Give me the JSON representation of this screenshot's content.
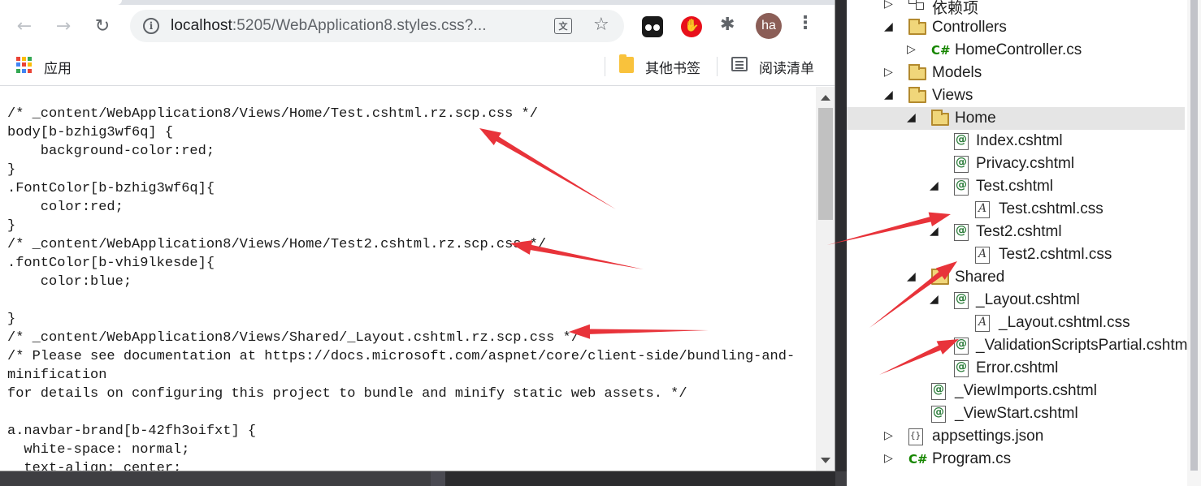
{
  "browser": {
    "url_host": "localhost",
    "url_rest": ":5205/WebApplication8.styles.css?...",
    "avatar_initials": "ha",
    "bookmarks": {
      "apps_label": "应用",
      "other_bookmarks": "其他书签",
      "reading_list": "阅读清单"
    }
  },
  "code_lines": [
    "/* _content/WebApplication8/Views/Home/Test.cshtml.rz.scp.css */",
    "body[b-bzhig3wf6q] {",
    "    background-color:red;",
    "}",
    ".FontColor[b-bzhig3wf6q]{",
    "    color:red;",
    "}",
    "/* _content/WebApplication8/Views/Home/Test2.cshtml.rz.scp.css */",
    ".fontColor[b-vhi9lkesde]{",
    "    color:blue;",
    "",
    "}",
    "/* _content/WebApplication8/Views/Shared/_Layout.cshtml.rz.scp.css */",
    "/* Please see documentation at https://docs.microsoft.com/aspnet/core/client-side/bundling-and-",
    "minification",
    "for details on configuring this project to bundle and minify static web assets. */",
    "",
    "a.navbar-brand[b-42fh3oifxt] {",
    "  white-space: normal;",
    "  text-align: center;"
  ],
  "explorer": {
    "items": [
      {
        "label": "依赖项",
        "icon": "dependencies-icon",
        "arrow": "▷",
        "level": 0
      },
      {
        "label": "Controllers",
        "icon": "folder-icon",
        "arrow": "◢",
        "level": 0
      },
      {
        "label": "HomeController.cs",
        "icon": "csharp-file-icon",
        "arrow": "▷",
        "level": 1
      },
      {
        "label": "Models",
        "icon": "folder-icon",
        "arrow": "▷",
        "level": 0
      },
      {
        "label": "Views",
        "icon": "folder-icon",
        "arrow": "◢",
        "level": 0
      },
      {
        "label": "Home",
        "icon": "folder-icon",
        "arrow": "◢",
        "level": 1,
        "selected": true
      },
      {
        "label": "Index.cshtml",
        "icon": "razor-file-icon",
        "arrow": "",
        "level": 2
      },
      {
        "label": "Privacy.cshtml",
        "icon": "razor-file-icon",
        "arrow": "",
        "level": 2
      },
      {
        "label": "Test.cshtml",
        "icon": "razor-file-icon",
        "arrow": "◢",
        "level": 2
      },
      {
        "label": "Test.cshtml.css",
        "icon": "css-file-icon",
        "arrow": "",
        "level": 3
      },
      {
        "label": "Test2.cshtml",
        "icon": "razor-file-icon",
        "arrow": "◢",
        "level": 2
      },
      {
        "label": "Test2.cshtml.css",
        "icon": "css-file-icon",
        "arrow": "",
        "level": 3
      },
      {
        "label": "Shared",
        "icon": "folder-icon",
        "arrow": "◢",
        "level": 1
      },
      {
        "label": "_Layout.cshtml",
        "icon": "razor-file-icon",
        "arrow": "◢",
        "level": 2
      },
      {
        "label": "_Layout.cshtml.css",
        "icon": "css-file-icon",
        "arrow": "",
        "level": 3
      },
      {
        "label": "_ValidationScriptsPartial.cshtml",
        "icon": "razor-file-icon",
        "arrow": "",
        "level": 2
      },
      {
        "label": "Error.cshtml",
        "icon": "razor-file-icon",
        "arrow": "",
        "level": 2
      },
      {
        "label": "_ViewImports.cshtml",
        "icon": "razor-file-icon",
        "arrow": "",
        "level": 1
      },
      {
        "label": "_ViewStart.cshtml",
        "icon": "razor-file-icon",
        "arrow": "",
        "level": 1
      },
      {
        "label": "appsettings.json",
        "icon": "json-file-icon",
        "arrow": "▷",
        "level": 0
      },
      {
        "label": "Program.cs",
        "icon": "csharp-file-icon",
        "arrow": "▷",
        "level": 0
      }
    ]
  },
  "colors": {
    "annotation_arrow": "#e8333a",
    "selected_row": "#e5e5e5"
  }
}
